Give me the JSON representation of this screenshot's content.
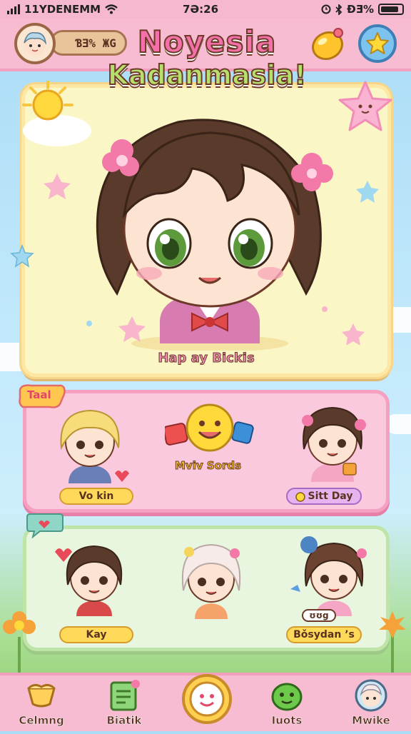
{
  "status": {
    "carrier": "11YDENEMM",
    "time": "7Ə:26",
    "battery": "ƉƎ%"
  },
  "header": {
    "coins": "ƁƎ% ЖG",
    "title_line1": "Noyesia",
    "title_line2": "Kadanmasia!"
  },
  "hero": {
    "caption": "Hap ay Bickis"
  },
  "panel1": {
    "tag": "Taal",
    "center_title": "Mviv Sords",
    "left_label": "Vo kin",
    "right_label": "Sitt Day"
  },
  "panel2": {
    "left_label": "Kay",
    "right_badge": "ʊʊg",
    "right_label": "Bǒsydan ʼs"
  },
  "nav": {
    "items": [
      {
        "label": "Celmng",
        "icon": "bell-icon"
      },
      {
        "label": "Biatik",
        "icon": "notebook-icon"
      },
      {
        "label": "",
        "icon": "smiley-center-icon"
      },
      {
        "label": "Iuots",
        "icon": "green-blob-icon"
      },
      {
        "label": "Mwike",
        "icon": "character-face-icon"
      }
    ]
  },
  "colors": {
    "top_bar": "#f7bcd2",
    "panel_pink": "#fbc9dd",
    "panel_green": "#e9f6df",
    "hero_bg": "#fbf6c6",
    "pill_yellow": "#ffd95a",
    "pill_purple": "#e6b5f0",
    "title_pink": "#f56fa8",
    "title_green": "#b6e06b"
  }
}
